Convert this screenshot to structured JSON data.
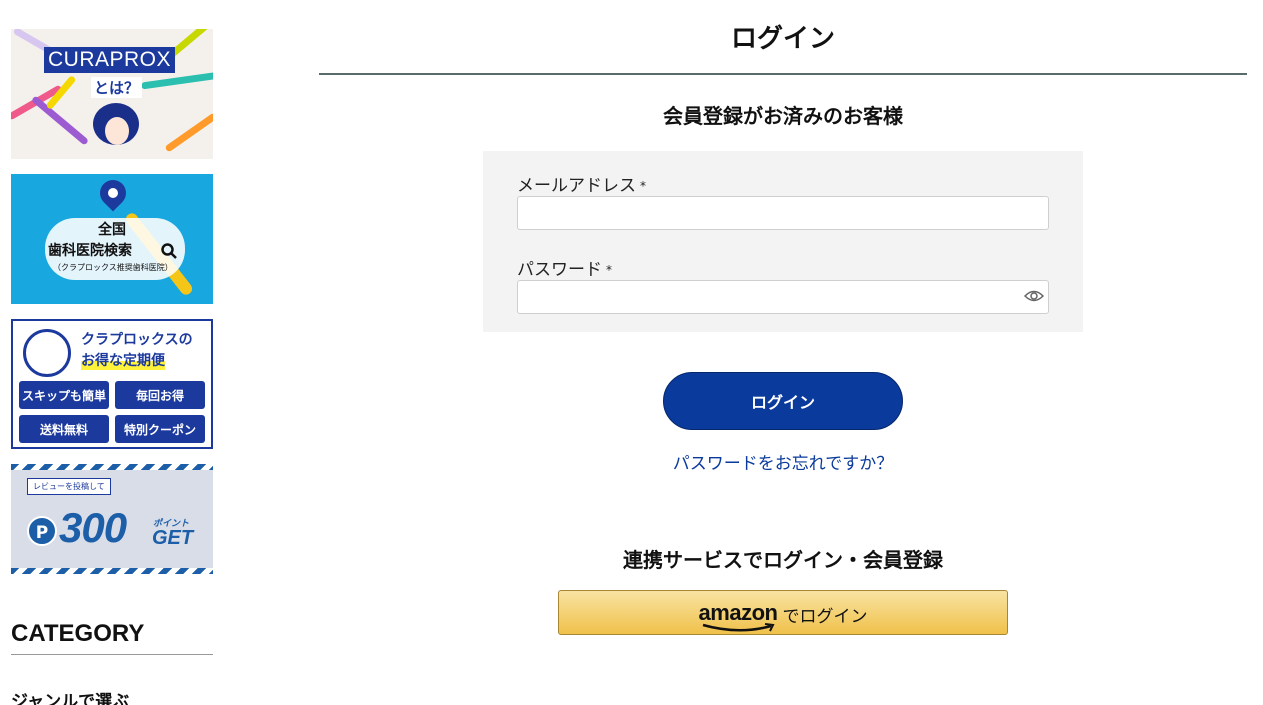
{
  "sidebar": {
    "banner1": {
      "brand": "CURAPROX",
      "sub": "とは？"
    },
    "banner2": {
      "line1": "全国",
      "line2": "歯科医院検索",
      "line3": "（クラプロックス推奨歯科医院）"
    },
    "banner3": {
      "title1": "クラプロックスの",
      "title2": "お得な定期便",
      "pills": [
        "スキップも簡単",
        "毎回お得",
        "送料無料",
        "特別クーポン"
      ]
    },
    "banner4": {
      "tag": "レビューを投稿して",
      "coin": "P",
      "points": "300",
      "points_unit": "ポイント",
      "get": "GET"
    },
    "category_heading": "CATEGORY",
    "genre_heading": "ジャンルで選ぶ"
  },
  "main": {
    "title": "ログイン",
    "section_title": "会員登録がお済みのお客様",
    "email_label": "メールアドレス",
    "password_label": "パスワード",
    "required_mark": "*",
    "email_value": "",
    "password_value": "",
    "login_button": "ログイン",
    "forgot_link": "パスワードをお忘れですか？",
    "linked_title": "連携サービスでログイン・会員登録",
    "amazon_logo": "amazon",
    "amazon_text": "でログイン"
  },
  "colors": {
    "brand_blue": "#0a3a9c",
    "amazon_gold": "#f0c14b"
  }
}
